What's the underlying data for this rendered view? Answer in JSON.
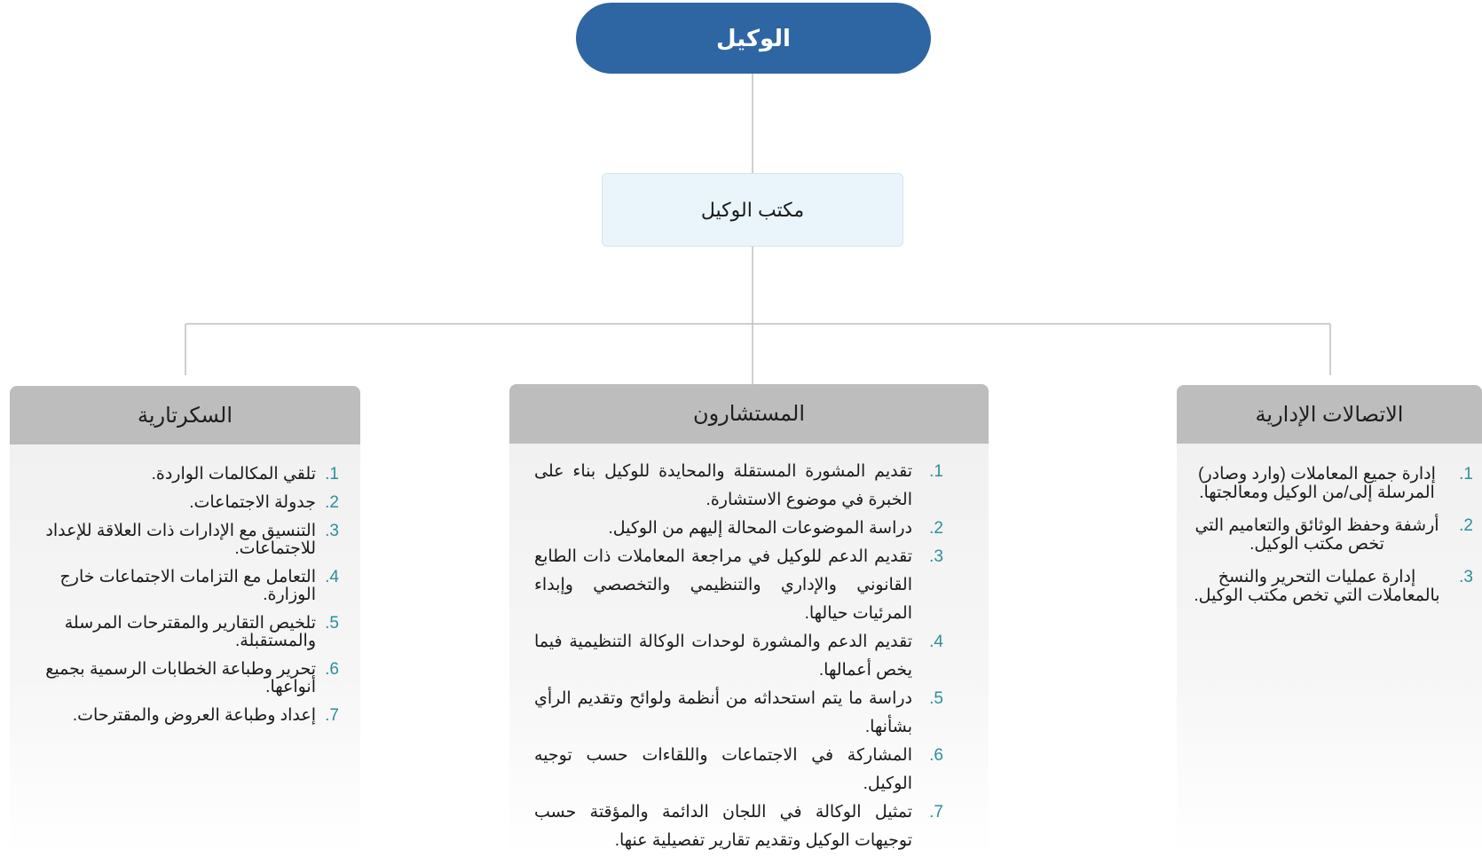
{
  "top": {
    "title": "الوكيل"
  },
  "office": {
    "title": "مكتب الوكيل"
  },
  "branches": {
    "right": {
      "title": "الاتصالات الإدارية",
      "items": [
        {
          "num": "1.",
          "text": "إدارة جميع المعاملات (وارد وصادر) المرسلة إلى/من الوكيل ومعالجتها."
        },
        {
          "num": "2.",
          "text": "أرشفة وحفظ الوثائق والتعاميم التي تخص مكتب الوكيل."
        },
        {
          "num": "3.",
          "text": "إدارة عمليات التحرير والنسخ بالمعاملات التي تخص مكتب الوكيل."
        }
      ]
    },
    "center": {
      "title": "المستشارون",
      "items": [
        {
          "num": "1.",
          "text": "تقديم المشورة المستقلة والمحايدة للوكيل بناء على الخبرة في موضوع الاستشارة."
        },
        {
          "num": "2.",
          "text": "دراسة الموضوعات المحالة إليهم من الوكيل."
        },
        {
          "num": "3.",
          "text": "تقديم الدعم للوكيل في مراجعة المعاملات ذات الطابع القانوني والإداري والتنظيمي والتخصصي وإبداء المرئيات حيالها."
        },
        {
          "num": "4.",
          "text": "تقديم الدعم والمشورة لوحدات الوكالة التنظيمية فيما يخص أعمالها."
        },
        {
          "num": "5.",
          "text": "دراسة ما يتم استحداثه من أنظمة ولوائح وتقديم الرأي بشأنها."
        },
        {
          "num": "6.",
          "text": "المشاركة في الاجتماعات واللقاءات حسب توجيه الوكيل."
        },
        {
          "num": "7.",
          "text": "تمثيل الوكالة في اللجان الدائمة والمؤقتة حسب توجيهات الوكيل وتقديم تقارير تفصيلية عنها."
        }
      ]
    },
    "left": {
      "title": "السكرتارية",
      "items": [
        {
          "num": "1.",
          "text": "تلقي المكالمات الواردة."
        },
        {
          "num": "2.",
          "text": "جدولة الاجتماعات."
        },
        {
          "num": "3.",
          "text": "التنسيق مع الإدارات ذات العلاقة للإعداد للاجتماعات."
        },
        {
          "num": "4.",
          "text": "التعامل مع التزامات الاجتماعات خارج الوزارة."
        },
        {
          "num": "5.",
          "text": "تلخيص التقارير والمقترحات المرسلة والمستقبلة."
        },
        {
          "num": "6.",
          "text": "تحرير وطباعة الخطابات الرسمية بجميع أنواعها."
        },
        {
          "num": "7.",
          "text": "إعداد وطباعة العروض والمقترحات."
        }
      ]
    }
  },
  "colors": {
    "top_fill": "#2e66a3",
    "office_fill": "#eaf5fb",
    "header_fill": "#bdbdbd",
    "number_color": "#2a8f9a",
    "connector": "#bfbfbf"
  }
}
